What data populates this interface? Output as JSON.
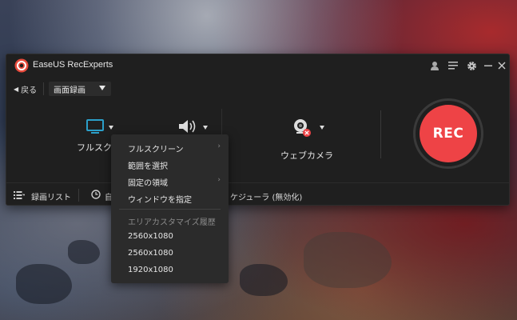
{
  "app": {
    "title": "EaseUS RecExperts"
  },
  "toolbar": {
    "back_label": "戻る",
    "mode_value": "画面録画"
  },
  "sources": {
    "screen_label": "フルスクリーン",
    "webcam_label": "ウェブカメラ"
  },
  "rec_label": "REC",
  "bottom": {
    "list_label": "録画リスト",
    "auto_label": "自",
    "scheduler_label": "ケジューラ (無効化)"
  },
  "menu": {
    "items": [
      {
        "label": "フルスクリーン",
        "has_sub": true
      },
      {
        "label": "範囲を選択",
        "has_sub": false
      },
      {
        "label": "固定の領域",
        "has_sub": true
      },
      {
        "label": "ウィンドウを指定",
        "has_sub": false
      }
    ],
    "history_header": "エリアカスタマイズ履歴",
    "history": [
      "2560x1080",
      "2560x1080",
      "1920x1080"
    ]
  },
  "colors": {
    "rec": "#ee4346",
    "window": "#1f1f1f",
    "menu": "#2b2b2b",
    "screen_icon": "#2b9fc9"
  }
}
